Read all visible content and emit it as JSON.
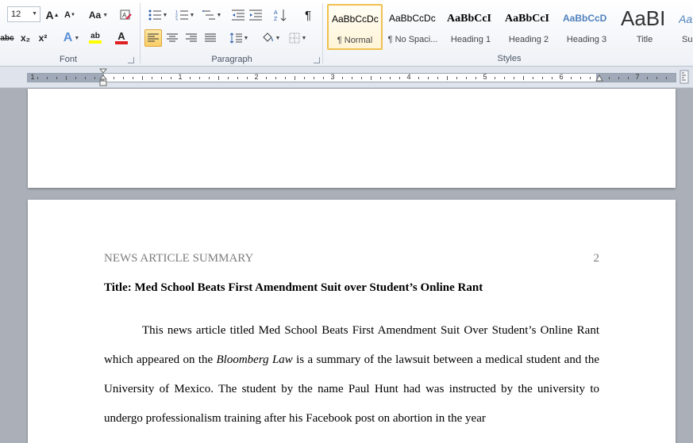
{
  "ribbon": {
    "font": {
      "label": "Font",
      "size_value": "12",
      "grow_label": "A",
      "shrink_label": "A",
      "change_case_label": "Aa",
      "strike_label": "abc",
      "subscript_label": "x₂",
      "superscript_label": "x²",
      "effects_label": "A",
      "highlight_label": "ab",
      "font_color_label": "A",
      "highlight_color": "#ffff00",
      "font_color": "#e02020"
    },
    "paragraph": {
      "label": "Paragraph",
      "show_marks_label": "¶"
    },
    "styles": {
      "label": "Styles",
      "items": [
        {
          "preview": "AaBbCcDc",
          "name": "¶ Normal"
        },
        {
          "preview": "AaBbCcDc",
          "name": "¶ No Spaci..."
        },
        {
          "preview": "AaBbCcI",
          "name": "Heading 1"
        },
        {
          "preview": "AaBbCcI",
          "name": "Heading 2"
        },
        {
          "preview": "AaBbCcD",
          "name": "Heading 3"
        },
        {
          "preview": "AaBI",
          "name": "Title"
        },
        {
          "preview": "AaB",
          "name": "Su"
        }
      ],
      "heading_color": "#4f81bd"
    }
  },
  "ruler": {
    "numbers": [
      "1",
      "1",
      "2",
      "3",
      "4",
      "5",
      "6",
      "7"
    ]
  },
  "document": {
    "header": "NEWS ARTICLE SUMMARY",
    "page_number": "2",
    "title": "Title: Med School Beats First Amendment Suit over Student’s Online Rant",
    "body_part1": "This news article titled Med School Beats First Amendment Suit Over Student’s Online Rant which appeared on the ",
    "body_italic": "Bloomberg Law",
    "body_part2": " is a summary of the lawsuit between a medical student and the University of Mexico. The student by the name Paul Hunt had was instructed by the university to undergo professionalism training after his Facebook post on abortion in the year"
  }
}
